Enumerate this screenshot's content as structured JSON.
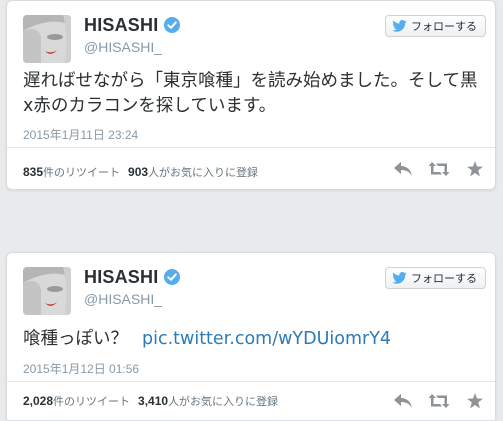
{
  "tweets": [
    {
      "display_name": "HISASHI",
      "handle": "@HISASHI_",
      "follow_label": "フォローする",
      "text": "遅ればせながら「東京喰種」を読み始めました。そして黒x赤のカラコンを探しています。",
      "link": "",
      "timestamp": "2015年1月11日  23:24",
      "retweet_count": "835",
      "retweet_label": "件のリツイート",
      "fav_count": "903",
      "fav_label": "人がお気に入りに登録"
    },
    {
      "display_name": "HISASHI",
      "handle": "@HISASHI_",
      "follow_label": "フォローする",
      "text": "喰種っぽい？",
      "link": "pic.twitter.com/wYDUiomrY4",
      "timestamp": "2015年1月12日  01:56",
      "retweet_count": "2,028",
      "retweet_label": "件のリツイート",
      "fav_count": "3,410",
      "fav_label": "人がお気に入りに登録"
    }
  ],
  "icons": {
    "verified": "verified-badge-icon",
    "follow": "twitter-bird-icon",
    "reply": "reply-icon",
    "retweet": "retweet-icon",
    "favorite": "star-icon"
  },
  "colors": {
    "background": "#e9eaec",
    "link": "#2b7bb9",
    "verified": "#55acee",
    "muted": "#8899a6"
  }
}
